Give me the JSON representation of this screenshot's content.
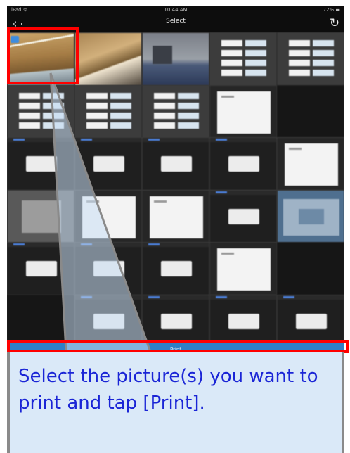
{
  "status_bar": {
    "carrier": "iPad ᯤ",
    "time": "10:44 AM",
    "battery": "72% ▬"
  },
  "nav_bar": {
    "back_icon": "back-arrow-icon",
    "back_glyph": "⇦",
    "title": "Select",
    "refresh_icon": "refresh-icon",
    "refresh_glyph": "↻"
  },
  "grid": {
    "columns": 5,
    "thumbnails": [
      {
        "kind": "photo-1",
        "selected": true
      },
      {
        "kind": "photo-2",
        "selected": false
      },
      {
        "kind": "photo-3",
        "selected": false
      },
      {
        "kind": "form",
        "selected": false
      },
      {
        "kind": "form",
        "selected": false
      },
      {
        "kind": "form",
        "selected": false
      },
      {
        "kind": "form",
        "selected": false
      },
      {
        "kind": "form",
        "selected": false
      },
      {
        "kind": "sheet",
        "selected": false
      },
      {
        "kind": "empty",
        "selected": false
      },
      {
        "kind": "dialog",
        "selected": false
      },
      {
        "kind": "dialog",
        "selected": false
      },
      {
        "kind": "dialog",
        "selected": false
      },
      {
        "kind": "dialog",
        "selected": false
      },
      {
        "kind": "sheet",
        "selected": false
      },
      {
        "kind": "greybox",
        "selected": false
      },
      {
        "kind": "sheet",
        "selected": false
      },
      {
        "kind": "sheet",
        "selected": false
      },
      {
        "kind": "dialog",
        "selected": false
      },
      {
        "kind": "map",
        "selected": false
      },
      {
        "kind": "dialog",
        "selected": false
      },
      {
        "kind": "dialog",
        "selected": false
      },
      {
        "kind": "dialog",
        "selected": false
      },
      {
        "kind": "sheet",
        "selected": false
      },
      {
        "kind": "empty",
        "selected": false
      },
      {
        "kind": "empty",
        "selected": false
      },
      {
        "kind": "dialog",
        "selected": false
      },
      {
        "kind": "dialog",
        "selected": false
      },
      {
        "kind": "dialog",
        "selected": false
      },
      {
        "kind": "dialog",
        "selected": false
      }
    ]
  },
  "print_bar": {
    "label": "Print"
  },
  "callout": {
    "text": "Select the picture(s) you want to print and tap [Print].",
    "text_color": "#1a25d6",
    "background": "#dae9f8",
    "highlight_color": "#ff0000"
  }
}
